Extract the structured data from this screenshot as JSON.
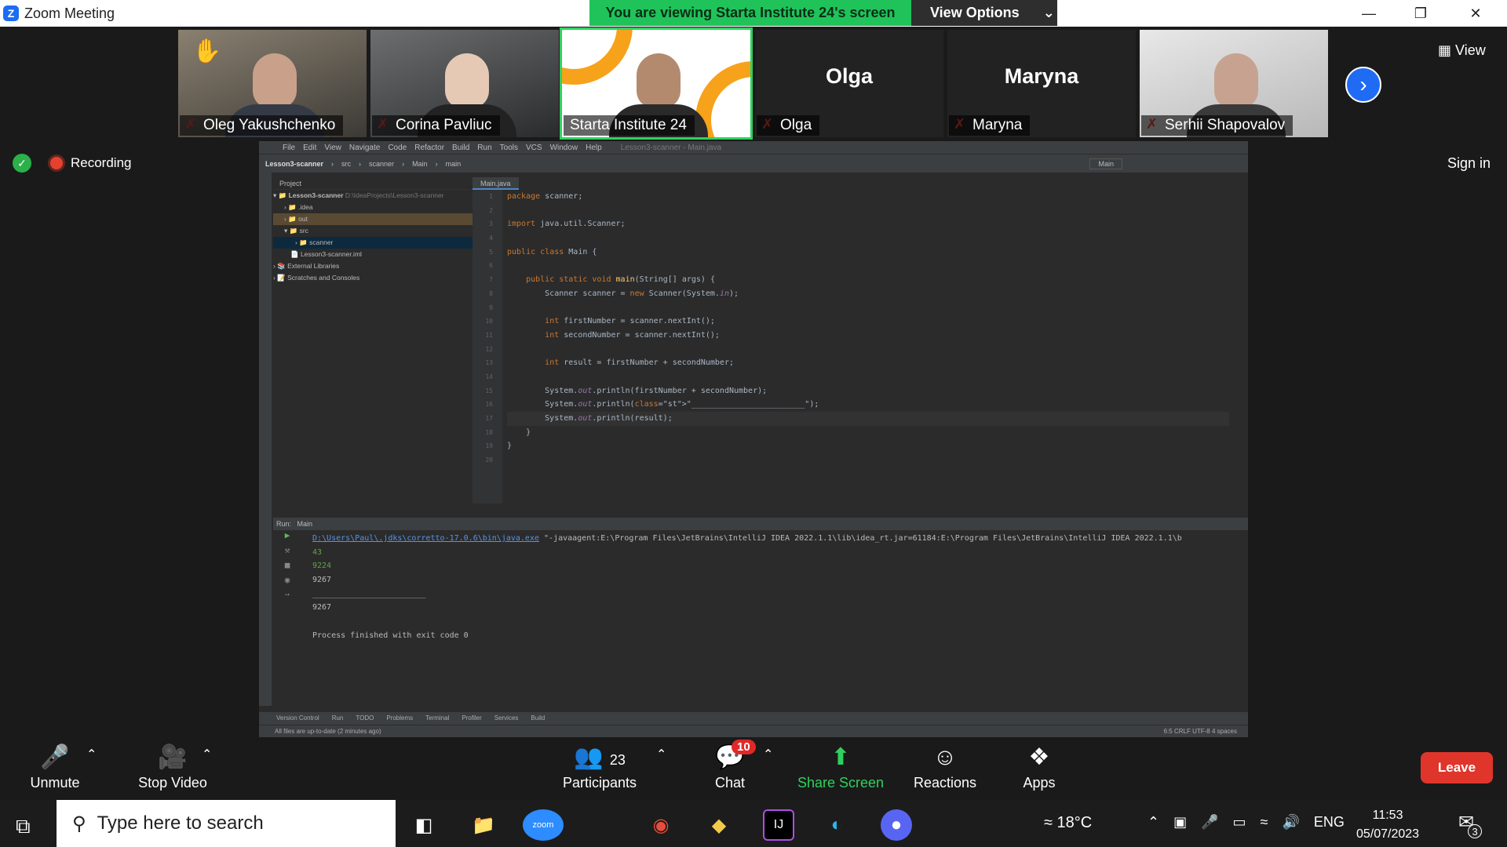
{
  "window": {
    "title": "Zoom Meeting"
  },
  "banner": {
    "viewing": "You are viewing Starta Institute 24's screen",
    "options": "View Options"
  },
  "participants": [
    {
      "name": "Oleg Yakushchenko"
    },
    {
      "name": "Corina Pavliuc"
    },
    {
      "name": "Starta Institute 24"
    },
    {
      "name": "Olga"
    },
    {
      "name": "Maryna"
    },
    {
      "name": "Serhii Shapovalov"
    }
  ],
  "gallery": {
    "view_label": "View"
  },
  "status": {
    "recording": "Recording",
    "sign_in": "Sign in"
  },
  "ide": {
    "menu": [
      "File",
      "Edit",
      "View",
      "Navigate",
      "Code",
      "Refactor",
      "Build",
      "Run",
      "Tools",
      "VCS",
      "Window",
      "Help"
    ],
    "window_file": "Lesson3-scanner - Main.java",
    "breadcrumb": [
      "Lesson3-scanner",
      "src",
      "scanner",
      "Main",
      "main"
    ],
    "run_config": "Main",
    "project_label": "Project",
    "tree": [
      {
        "label": "Lesson3-scanner",
        "path": "D:\\IdeaProjects\\Lesson3-scanner"
      },
      {
        "label": ".idea"
      },
      {
        "label": "out"
      },
      {
        "label": "src"
      },
      {
        "label": "scanner"
      },
      {
        "label": "Lesson3-scanner.iml"
      },
      {
        "label": "External Libraries"
      },
      {
        "label": "Scratches and Consoles"
      }
    ],
    "editor_tab": "Main.java",
    "line_numbers": [
      "1",
      "2",
      "3",
      "4",
      "5",
      "6",
      "7",
      "8",
      "9",
      "10",
      "11",
      "12",
      "13",
      "14",
      "15",
      "16",
      "17",
      "18",
      "19",
      "20"
    ],
    "code": [
      "package scanner;",
      "",
      "import java.util.Scanner;",
      "",
      "public class Main {",
      "",
      "    public static void main(String[] args) {",
      "        Scanner scanner = new Scanner(System.in);",
      "",
      "        int firstNumber = scanner.nextInt();",
      "        int secondNumber = scanner.nextInt();",
      "",
      "        int result = firstNumber + secondNumber;",
      "",
      "        System.out.println(firstNumber + secondNumber);",
      "        System.out.println(\"________________________\");",
      "        System.out.println(result);",
      "    }",
      "}",
      ""
    ],
    "run_label": "Run:",
    "run_tab": "Main",
    "console_cmd_link": "D:\\Users\\Paul\\.jdks\\corretto-17.0.6\\bin\\java.exe",
    "console_cmd_rest": " \"-javaagent:E:\\Program Files\\JetBrains\\IntelliJ IDEA 2022.1.1\\lib\\idea_rt.jar=61184:E:\\Program Files\\JetBrains\\IntelliJ IDEA 2022.1.1\\b",
    "console_input1": "43",
    "console_input2": "9224",
    "console_out1": "9267",
    "console_line": "________________________",
    "console_out2": "9267",
    "console_exit": "Process finished with exit code 0",
    "bottom_tabs": [
      "Version Control",
      "Run",
      "TODO",
      "Problems",
      "Terminal",
      "Profiler",
      "Services",
      "Build"
    ],
    "status_left": "All files are up-to-date (2 minutes ago)",
    "status_right": "6:5  CRLF  UTF-8  4 spaces"
  },
  "controls": {
    "unmute": "Unmute",
    "stop_video": "Stop Video",
    "participants_count": "23",
    "participants": "Participants",
    "chat_badge": "10",
    "chat": "Chat",
    "share": "Share Screen",
    "reactions": "Reactions",
    "apps": "Apps",
    "leave": "Leave"
  },
  "taskbar": {
    "search_placeholder": "Type here to search",
    "zoom_label": "zoom",
    "temperature": "18°C",
    "language": "ENG",
    "time": "11:53",
    "date": "05/07/2023",
    "notifications": "3"
  },
  "colors": {
    "accent": "#1f6bf4",
    "green": "#20c35a",
    "leave": "#e0352b"
  }
}
